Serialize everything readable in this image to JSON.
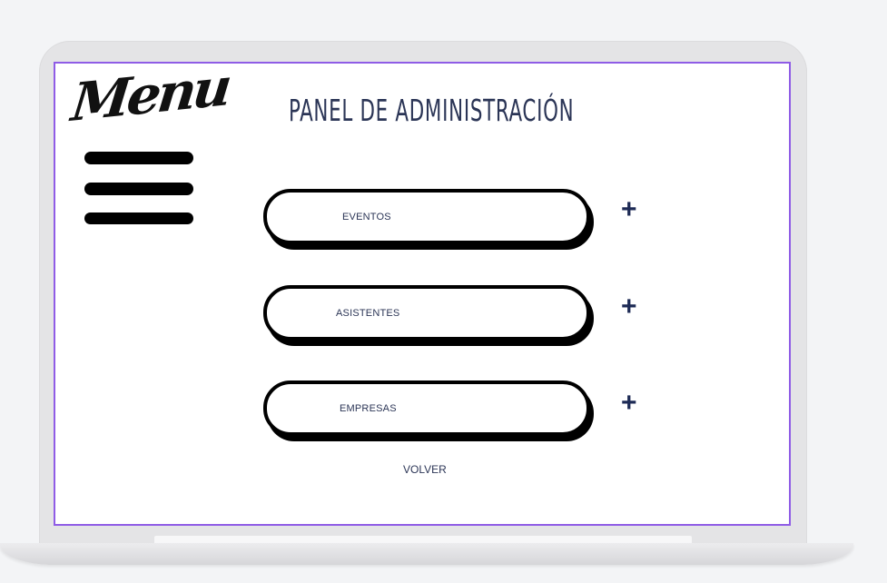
{
  "menu": {
    "label": "Menu"
  },
  "page": {
    "title": "PANEL DE ADMINISTRACIÓN"
  },
  "items": [
    {
      "label": "EVENTOS",
      "action": "+"
    },
    {
      "label": "ASISTENTES",
      "action": "+"
    },
    {
      "label": "EMPRESAS",
      "action": "+"
    }
  ],
  "footer": {
    "back_label": "VOLVER"
  },
  "colors": {
    "accent_border": "#8f5ce6",
    "text_navy": "#2b3556",
    "plus_navy": "#1d2a55"
  },
  "icons": {
    "hamburger": "hamburger-menu-icon",
    "add": "plus-icon"
  }
}
